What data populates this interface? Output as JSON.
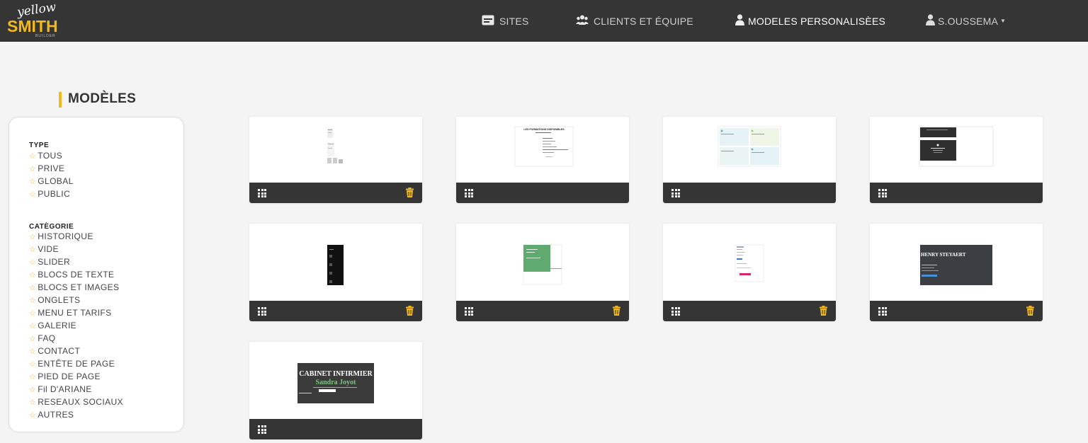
{
  "app": {
    "logo_script": "yellow",
    "logo_brand": "SMITH",
    "logo_sub": "BUILDER"
  },
  "nav": {
    "sites": "SITES",
    "clients": "CLIENTS ET ÉQUIPE",
    "modeles": "MODELES PERSONALISÈES",
    "user": "S.OUSSEMA"
  },
  "page": {
    "title": "MODÈLES"
  },
  "filters": {
    "type_title": "TYPE",
    "type_items": [
      "TOUS",
      "PRIVE",
      "GLOBAL",
      "PUBLIC"
    ],
    "category_title": "CATÈGORIE",
    "category_items": [
      "HISTORIQUE",
      "VIDE",
      "SLIDER",
      "BLOCS DE TEXTE",
      "BLOCS ET IMAGES",
      "ONGLETS",
      "MENU ET TARIFS",
      "GALERIE",
      "FAQ",
      "CONTACT",
      "ENTÊTE DE PAGE",
      "PIED DE PAGE",
      "Fil D'ARIANE",
      "RESEAUX SOCIAUX",
      "AUTRES"
    ]
  },
  "templates": {
    "t2_heading": "LES FORMATIONS DISPONIBLES",
    "t8_name": "HENRY STEYAERT",
    "t9_title": "CABINET INFIRMIER",
    "t9_name": "Sandra Joyot"
  },
  "colors": {
    "accent": "#f2b81c",
    "topbar": "#353535",
    "card_bar": "#353535"
  }
}
